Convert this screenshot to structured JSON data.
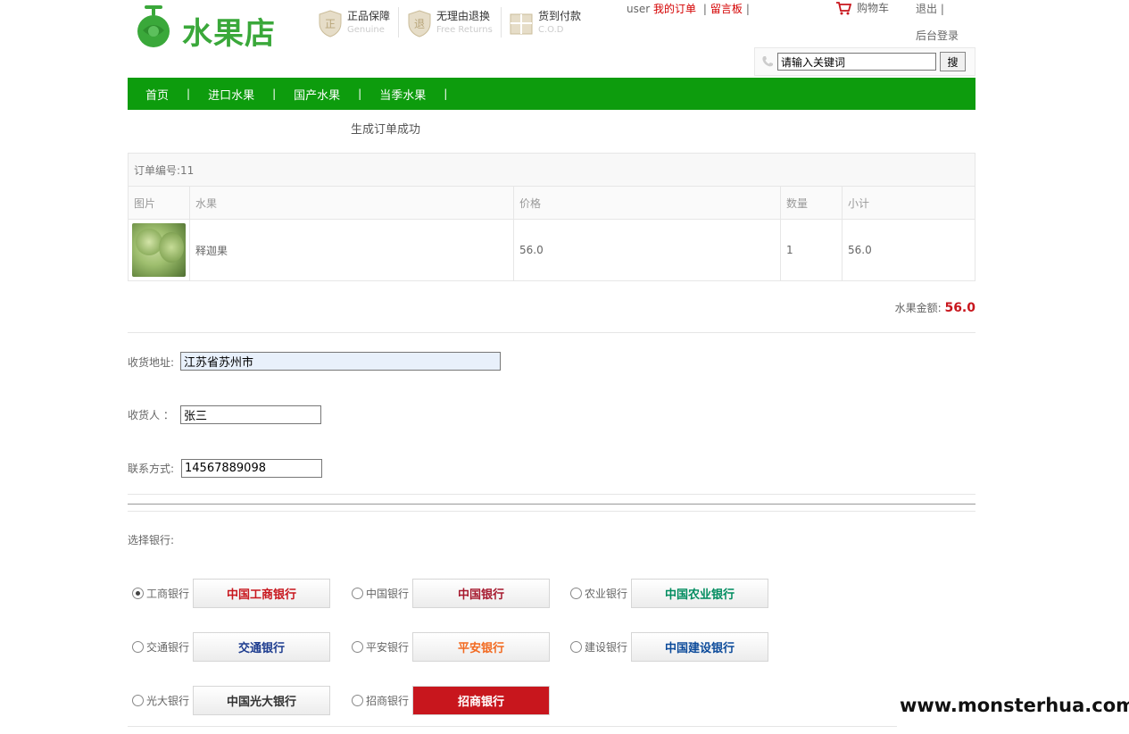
{
  "header": {
    "logo_text": "水果店",
    "promos": [
      {
        "cn": "正品保障",
        "en": "Genuine",
        "glyph": "正"
      },
      {
        "cn": "无理由退换",
        "en": "Free Returns",
        "glyph": "退"
      },
      {
        "cn": "货到付款",
        "en": "C.O.D",
        "glyph": "¥"
      }
    ],
    "user": "user",
    "my_orders": "我的订单",
    "message_board": "留言板",
    "cart": "购物车",
    "logout": "退出",
    "admin_login": "后台登录",
    "search": {
      "value": "请输入关键词",
      "button": "搜"
    }
  },
  "nav": {
    "items": [
      "首页",
      "进口水果",
      "国产水果",
      "当季水果"
    ]
  },
  "order": {
    "success_message": "生成订单成功",
    "order_number_label": "订单编号:11",
    "columns": [
      "图片",
      "水果",
      "价格",
      "数量",
      "小计"
    ],
    "rows": [
      {
        "name": "释迦果",
        "price": "56.0",
        "qty": "1",
        "subtotal": "56.0"
      }
    ],
    "total_label": "水果金额:",
    "total_value": "56.0"
  },
  "form": {
    "address_label": "收货地址:",
    "address_value": "江苏省苏州市",
    "receiver_label": "收货人  ：",
    "receiver_value": "张三",
    "phone_label": "联系方式:",
    "phone_value": "14567889098"
  },
  "banks": {
    "title": "选择银行:",
    "items": [
      {
        "name": "工商银行",
        "logo_text": "中国工商银行",
        "color": "#c8161d",
        "selected": true
      },
      {
        "name": "中国银行",
        "logo_text": "中国银行",
        "color": "#a6192e",
        "selected": false
      },
      {
        "name": "农业银行",
        "logo_text": "中国农业银行",
        "color": "#008c5f",
        "selected": false
      },
      {
        "name": "交通银行",
        "logo_text": "交通银行",
        "color": "#1d3c8f",
        "selected": false
      },
      {
        "name": "平安银行",
        "logo_text": "平安银行",
        "color": "#f26a21",
        "selected": false
      },
      {
        "name": "建设银行",
        "logo_text": "中国建设银行",
        "color": "#0b4a9a",
        "selected": false
      },
      {
        "name": "光大银行",
        "logo_text": "中国光大银行",
        "color": "#e2a500",
        "selected": false
      },
      {
        "name": "招商银行",
        "logo_text": "招商银行",
        "color": "#c8161d",
        "selected": false
      }
    ]
  },
  "watermark": "www.monsterhua.com",
  "colors": {
    "nav_green": "#0d9c0d",
    "logo_green": "#3aa83a",
    "price_red": "#c8161d",
    "link_red": "#d40000"
  }
}
